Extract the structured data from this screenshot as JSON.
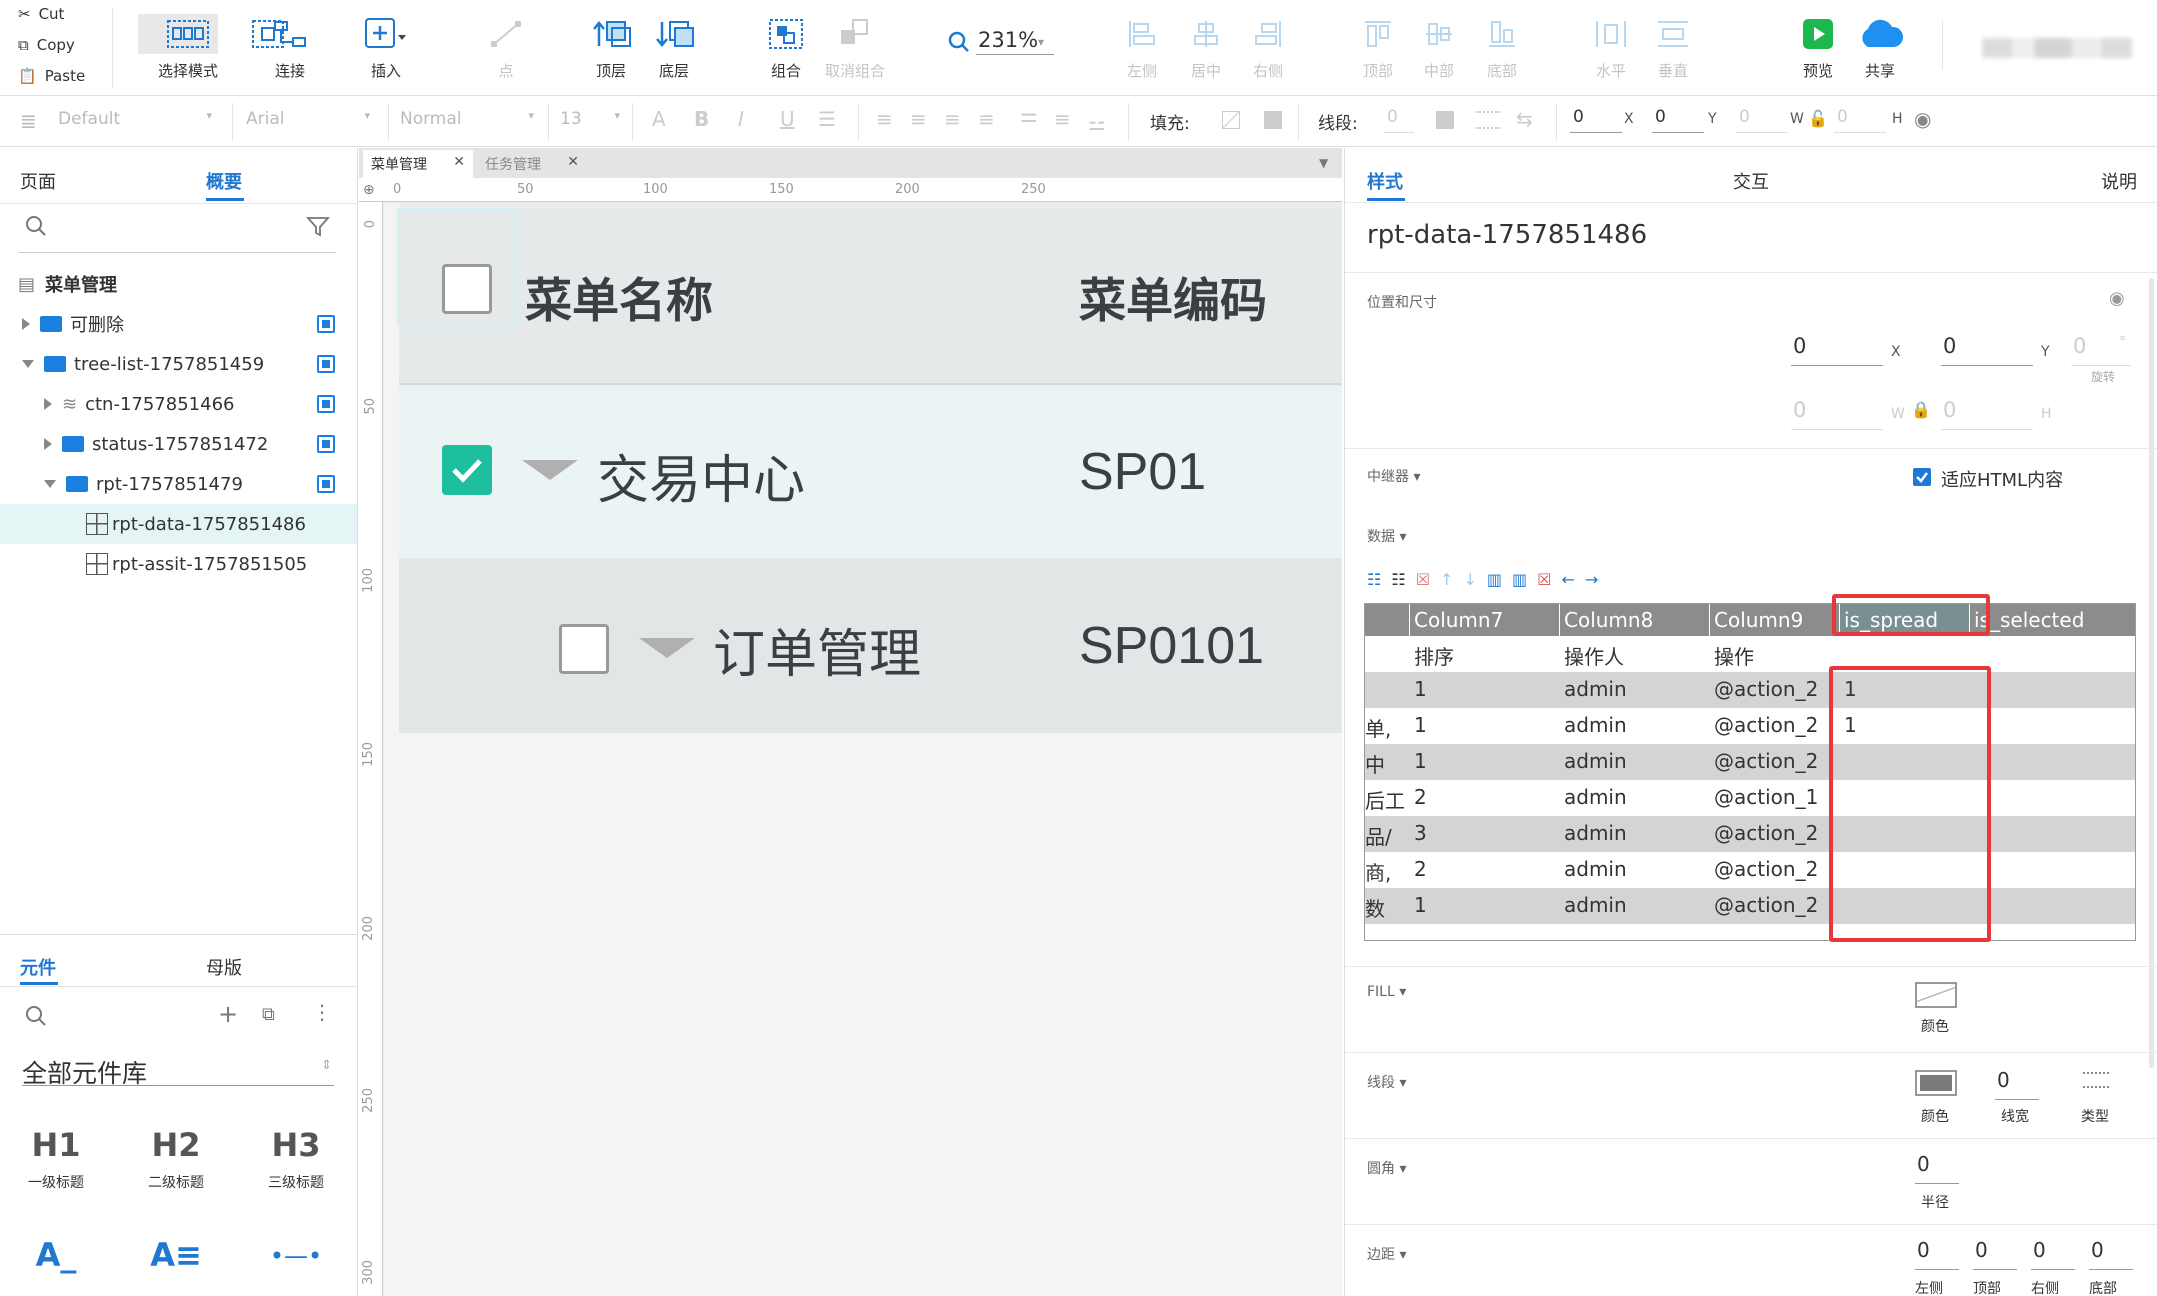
{
  "clipboard": {
    "cut": "Cut",
    "copy": "Copy",
    "paste": "Paste"
  },
  "toolbar": {
    "select_mode": "选择模式",
    "connect": "连接",
    "insert": "插入",
    "point": "点",
    "top_layer": "顶层",
    "bottom_layer": "底层",
    "group": "组合",
    "ungroup": "取消组合",
    "zoom": "231%",
    "align_left": "左侧",
    "align_center": "居中",
    "align_right": "右侧",
    "align_top": "顶部",
    "align_middle": "中部",
    "align_bottom": "底部",
    "distribute_h": "水平",
    "distribute_v": "垂直",
    "preview": "预览",
    "share": "共享"
  },
  "format_bar": {
    "style": "Default",
    "font": "Arial",
    "weight": "Normal",
    "size": "13",
    "fill_label": "填充:",
    "stroke_label": "线段:",
    "stroke_value": "0",
    "x_value": "0",
    "x_label": "X",
    "y_value": "0",
    "y_label": "Y",
    "w_value": "0",
    "w_label": "W",
    "h_value": "0",
    "h_label": "H"
  },
  "left_panel": {
    "tabs": [
      "页面",
      "概要"
    ],
    "tree": [
      {
        "label": "菜单管理"
      },
      {
        "label": "可删除"
      },
      {
        "label": "tree-list-1757851459"
      },
      {
        "label": "ctn-1757851466"
      },
      {
        "label": "status-1757851472"
      },
      {
        "label": "rpt-1757851479"
      },
      {
        "label": "rpt-data-1757851486"
      },
      {
        "label": "rpt-assit-1757851505"
      }
    ],
    "lib_tabs": [
      "元件",
      "母版"
    ],
    "lib_title": "全部元件库",
    "lib_items": [
      {
        "glyph": "H1",
        "label": "一级标题"
      },
      {
        "glyph": "H2",
        "label": "二级标题"
      },
      {
        "glyph": "H3",
        "label": "三级标题"
      }
    ]
  },
  "canvas": {
    "tabs": [
      "菜单管理",
      "任务管理"
    ],
    "ruler_h": [
      "0",
      "50",
      "100",
      "150",
      "200",
      "250"
    ],
    "ruler_v": [
      "0",
      "50",
      "100",
      "150",
      "200",
      "250",
      "300"
    ],
    "header": {
      "name": "菜单名称",
      "code": "菜单编码"
    },
    "rows": [
      {
        "name": "交易中心",
        "code": "SP01",
        "checked": true
      },
      {
        "name": "订单管理",
        "code": "SP0101",
        "checked": false
      }
    ]
  },
  "right_panel": {
    "tabs": [
      "样式",
      "交互",
      "说明"
    ],
    "widget_name": "rpt-data-1757851486",
    "pos_size_title": "位置和尺寸",
    "x": "0",
    "y": "0",
    "rot": "0",
    "w": "0",
    "h": "0",
    "x_label": "X",
    "y_label": "Y",
    "w_label": "W",
    "h_label": "H",
    "rot_unit": "°",
    "rot_label": "旋转",
    "repeater_title": "中继器 ▾",
    "fit_html": "适应HTML内容",
    "data_title": "数据 ▾",
    "columns": [
      "Column7",
      "Column8",
      "Column9",
      "is_spread",
      "is_selected"
    ],
    "rows": [
      {
        "c0": "",
        "c1": "排序",
        "c2": "操作人",
        "c3": "操作",
        "c4": "",
        "c5": ""
      },
      {
        "c0": "",
        "c1": "1",
        "c2": "admin",
        "c3": "@action_2",
        "c4": "1",
        "c5": ""
      },
      {
        "c0": "单,",
        "c1": "1",
        "c2": "admin",
        "c3": "@action_2",
        "c4": "1",
        "c5": ""
      },
      {
        "c0": "中",
        "c1": "1",
        "c2": "admin",
        "c3": "@action_2",
        "c4": "",
        "c5": ""
      },
      {
        "c0": "后工",
        "c1": "2",
        "c2": "admin",
        "c3": "@action_1",
        "c4": "",
        "c5": ""
      },
      {
        "c0": "品/",
        "c1": "3",
        "c2": "admin",
        "c3": "@action_2",
        "c4": "",
        "c5": ""
      },
      {
        "c0": "商,",
        "c1": "2",
        "c2": "admin",
        "c3": "@action_2",
        "c4": "",
        "c5": ""
      },
      {
        "c0": "数",
        "c1": "1",
        "c2": "admin",
        "c3": "@action_2",
        "c4": "",
        "c5": ""
      }
    ],
    "fill_title": "FILL ▾",
    "fill_color_label": "颜色",
    "stroke_title": "线段 ▾",
    "stroke_color_label": "颜色",
    "stroke_width": "0",
    "stroke_width_label": "线宽",
    "stroke_type_label": "类型",
    "radius_title": "圆角 ▾",
    "radius_value": "0",
    "radius_label": "半径",
    "padding_title": "边距 ▾",
    "padding_values": [
      "0",
      "0",
      "0",
      "0"
    ],
    "padding_labels": [
      "左侧",
      "顶部",
      "右侧",
      "底部"
    ]
  },
  "colors": {
    "accent": "#1f78d1",
    "highlight_red": "#e63a3a",
    "teal_check": "#1dbf9f"
  }
}
